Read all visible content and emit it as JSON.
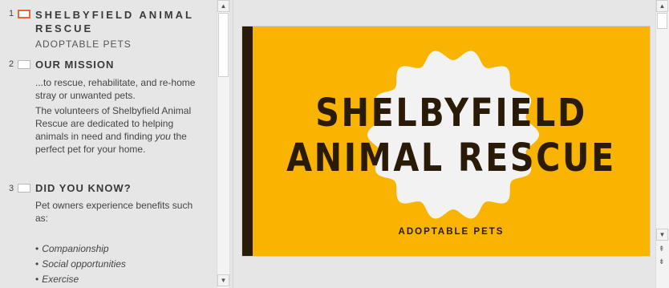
{
  "outline": {
    "slides": [
      {
        "number": "1",
        "title": "SHELBYFIELD ANIMAL RESCUE",
        "title_line1": "SHELBYFIELD ANIMAL",
        "title_line2": "RESCUE",
        "subtitle": "ADOPTABLE PETS"
      },
      {
        "number": "2",
        "title": "OUR MISSION",
        "body1_line1": "...to rescue, rehabilitate, and re-home",
        "body1_line2": "stray or unwanted pets.",
        "body2_line1": "The volunteers of Shelbyfield Animal",
        "body2_line2": "Rescue are dedicated to helping",
        "body2_line3_pre": "animals in need and finding ",
        "body2_line3_em": "you",
        "body2_line3_post": " the",
        "body2_line4": "perfect pet for your home."
      },
      {
        "number": "3",
        "title": "DID YOU KNOW?",
        "body_line1": "Pet owners experience benefits such",
        "body_line2": "as:",
        "bullets": [
          "Companionship",
          "Social opportunities",
          "Exercise"
        ]
      }
    ]
  },
  "slide": {
    "title_line1": "SHELBYFIELD",
    "title_line2": "ANIMAL RESCUE",
    "subtitle": "ADOPTABLE PETS",
    "background_color": "#f8b400",
    "accent_color": "#2a1a08",
    "badge_color": "#f2f2f2"
  },
  "icons": {
    "scroll_up": "▲",
    "scroll_down": "▼",
    "prev_slide": "⇞",
    "next_slide": "⇟"
  }
}
